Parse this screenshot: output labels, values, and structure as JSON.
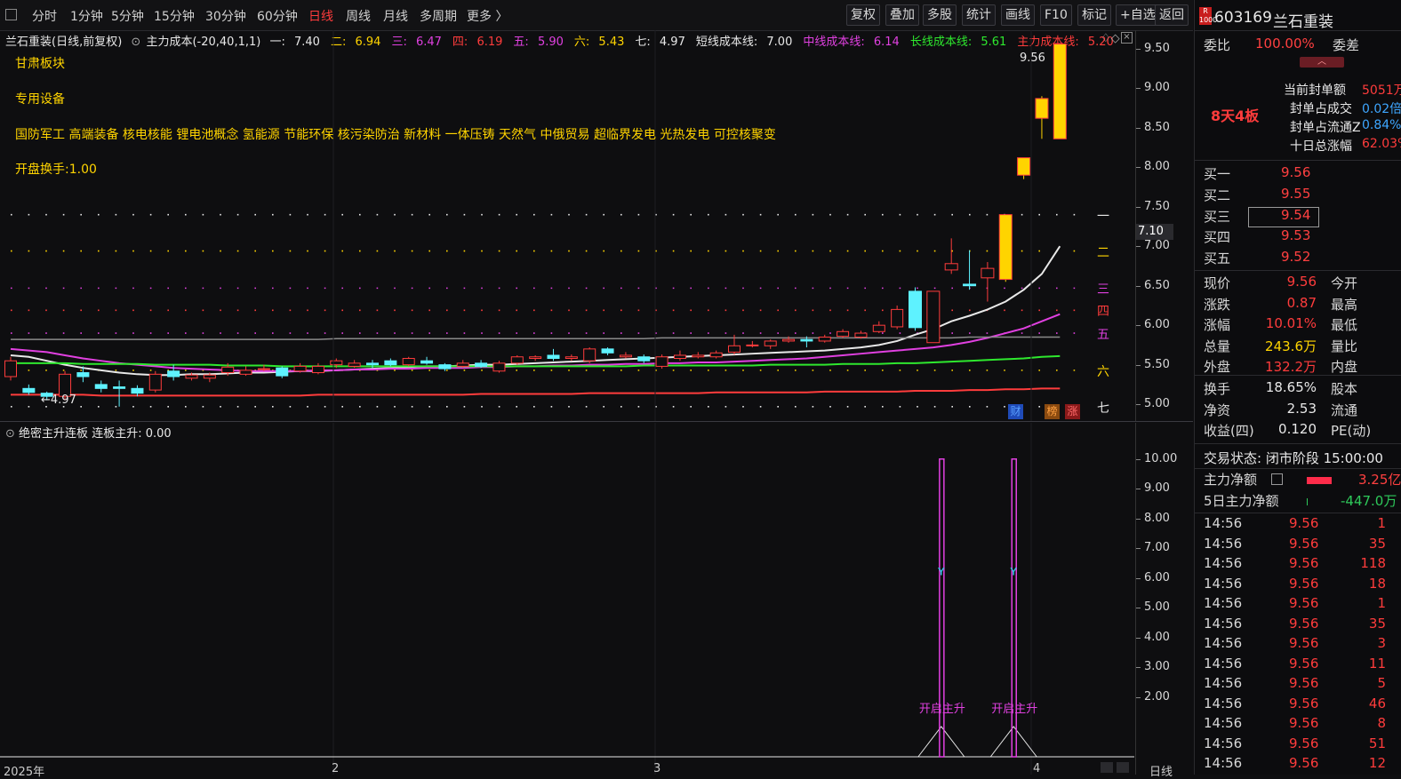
{
  "toolbar": {
    "checkbox_icon": "square-icon",
    "periods": [
      "分时",
      "1分钟",
      "5分钟",
      "15分钟",
      "30分钟",
      "60分钟",
      "日线",
      "周线",
      "月线",
      "多周期",
      "更多 〉"
    ],
    "active_period_index": 6,
    "buttons": [
      "复权",
      "叠加",
      "多股",
      "统计",
      "画线",
      "F10",
      "标记",
      "+自选",
      "返回"
    ]
  },
  "main_chart": {
    "title": "兰石重装(日线,前复权)",
    "indicator_name": "主力成本(-20,40,1,1)",
    "levels": [
      {
        "label": "一:",
        "value": "7.40",
        "color": "#e8e8e8"
      },
      {
        "label": "二:",
        "value": "6.94",
        "color": "#ffd400"
      },
      {
        "label": "三:",
        "value": "6.47",
        "color": "#e040e0"
      },
      {
        "label": "四:",
        "value": "6.19",
        "color": "#ff3c3c"
      },
      {
        "label": "五:",
        "value": "5.90",
        "color": "#e040e0"
      },
      {
        "label": "六:",
        "value": "5.43",
        "color": "#ffd400"
      },
      {
        "label": "七:",
        "value": "4.97",
        "color": "#e8e8e8"
      }
    ],
    "cost_lines": [
      {
        "label": "短线成本线:",
        "value": "7.00",
        "color": "#e8e8e8"
      },
      {
        "label": "中线成本线:",
        "value": "6.14",
        "color": "#e040e0"
      },
      {
        "label": "长线成本线:",
        "value": "5.61",
        "color": "#2ee82e"
      },
      {
        "label": "主力成本线:",
        "value": "5.20",
        "color": "#ff3c3c"
      }
    ],
    "sector": "甘肃板块",
    "industry": "专用设备",
    "concepts": "国防军工 高端装备 核电核能 锂电池概念 氢能源 节能环保 核污染防治 新材料 一体压铸 天然气 中俄贸易 超临界发电 光热发电 可控核聚变",
    "open_turnover": "开盘换手:1.00",
    "high_label": "9.56",
    "low_label": "4.97",
    "price_tag": "7.10",
    "level_marks": [
      "一",
      "二",
      "三",
      "四",
      "五",
      "六",
      "七"
    ],
    "badges": [
      "财",
      "榜",
      "涨"
    ],
    "y_ticks": [
      "9.50",
      "9.00",
      "8.50",
      "8.00",
      "7.50",
      "7.00",
      "6.50",
      "6.00",
      "5.50",
      "5.00"
    ]
  },
  "chart_data": {
    "type": "candlestick",
    "ylim": [
      4.9,
      9.6
    ],
    "y_ticks": [
      5.0,
      5.5,
      6.0,
      6.5,
      7.0,
      7.5,
      8.0,
      8.5,
      9.0,
      9.5
    ],
    "candles": [
      [
        5.35,
        5.55,
        5.6,
        5.3
      ],
      [
        5.2,
        5.15,
        5.25,
        5.12
      ],
      [
        5.14,
        5.1,
        5.16,
        5.05
      ],
      [
        5.1,
        5.38,
        5.42,
        5.05
      ],
      [
        5.4,
        5.35,
        5.48,
        5.28
      ],
      [
        5.25,
        5.2,
        5.3,
        5.15
      ],
      [
        5.22,
        5.2,
        5.3,
        4.97
      ],
      [
        5.2,
        5.14,
        5.24,
        5.1
      ],
      [
        5.18,
        5.38,
        5.42,
        5.15
      ],
      [
        5.42,
        5.35,
        5.5,
        5.3
      ],
      [
        5.33,
        5.37,
        5.4,
        5.3
      ],
      [
        5.33,
        5.37,
        5.4,
        5.28
      ],
      [
        5.4,
        5.47,
        5.52,
        5.36
      ],
      [
        5.38,
        5.43,
        5.48,
        5.36
      ],
      [
        5.45,
        5.45,
        5.5,
        5.42
      ],
      [
        5.46,
        5.36,
        5.48,
        5.33
      ],
      [
        5.42,
        5.48,
        5.52,
        5.4
      ],
      [
        5.4,
        5.48,
        5.52,
        5.38
      ],
      [
        5.5,
        5.55,
        5.58,
        5.46
      ],
      [
        5.48,
        5.52,
        5.56,
        5.46
      ],
      [
        5.52,
        5.5,
        5.56,
        5.46
      ],
      [
        5.55,
        5.5,
        5.58,
        5.48
      ],
      [
        5.5,
        5.58,
        5.6,
        5.48
      ],
      [
        5.55,
        5.52,
        5.6,
        5.5
      ],
      [
        5.5,
        5.45,
        5.52,
        5.42
      ],
      [
        5.48,
        5.52,
        5.56,
        5.46
      ],
      [
        5.52,
        5.48,
        5.56,
        5.46
      ],
      [
        5.42,
        5.52,
        5.55,
        5.4
      ],
      [
        5.52,
        5.6,
        5.62,
        5.5
      ],
      [
        5.58,
        5.6,
        5.62,
        5.55
      ],
      [
        5.62,
        5.58,
        5.7,
        5.55
      ],
      [
        5.58,
        5.6,
        5.63,
        5.55
      ],
      [
        5.55,
        5.7,
        5.72,
        5.52
      ],
      [
        5.7,
        5.65,
        5.72,
        5.62
      ],
      [
        5.6,
        5.62,
        5.66,
        5.58
      ],
      [
        5.6,
        5.55,
        5.63,
        5.52
      ],
      [
        5.48,
        5.6,
        5.63,
        5.45
      ],
      [
        5.58,
        5.62,
        5.68,
        5.55
      ],
      [
        5.6,
        5.62,
        5.66,
        5.58
      ],
      [
        5.6,
        5.65,
        5.68,
        5.58
      ],
      [
        5.66,
        5.74,
        5.88,
        5.63
      ],
      [
        5.74,
        5.75,
        5.8,
        5.72
      ],
      [
        5.74,
        5.8,
        5.82,
        5.7
      ],
      [
        5.8,
        5.82,
        5.86,
        5.78
      ],
      [
        5.82,
        5.8,
        5.86,
        5.72
      ],
      [
        5.8,
        5.85,
        5.88,
        5.78
      ],
      [
        5.86,
        5.92,
        5.95,
        5.84
      ],
      [
        5.85,
        5.9,
        5.93,
        5.83
      ],
      [
        5.92,
        6.0,
        6.05,
        5.9
      ],
      [
        5.98,
        6.2,
        6.25,
        5.95
      ],
      [
        6.43,
        5.97,
        6.48,
        5.93
      ],
      [
        5.78,
        6.43,
        6.43,
        5.78
      ],
      [
        6.7,
        6.78,
        7.1,
        6.65
      ],
      [
        6.52,
        6.5,
        6.95,
        6.45
      ],
      [
        6.6,
        6.72,
        6.8,
        6.3
      ],
      [
        6.58,
        7.4,
        7.4,
        6.55
      ],
      [
        7.9,
        8.12,
        8.12,
        7.85
      ],
      [
        8.62,
        8.87,
        8.9,
        8.36
      ],
      [
        8.36,
        9.56,
        9.56,
        8.36
      ]
    ],
    "series": [
      {
        "name": "短线成本线",
        "color": "#e8e8e8",
        "values": [
          5.62,
          5.6,
          5.55,
          5.5,
          5.46,
          5.43,
          5.4,
          5.38,
          5.37,
          5.37,
          5.38,
          5.38,
          5.39,
          5.4,
          5.4,
          5.41,
          5.42,
          5.42,
          5.43,
          5.44,
          5.45,
          5.46,
          5.47,
          5.48,
          5.48,
          5.49,
          5.5,
          5.5,
          5.51,
          5.52,
          5.53,
          5.54,
          5.55,
          5.56,
          5.57,
          5.58,
          5.59,
          5.6,
          5.61,
          5.62,
          5.63,
          5.64,
          5.65,
          5.66,
          5.67,
          5.68,
          5.7,
          5.72,
          5.75,
          5.8,
          5.88,
          5.95,
          6.05,
          6.12,
          6.2,
          6.3,
          6.45,
          6.65,
          7.0
        ]
      },
      {
        "name": "中线成本线",
        "color": "#e040e0",
        "values": [
          5.7,
          5.68,
          5.66,
          5.62,
          5.58,
          5.55,
          5.52,
          5.5,
          5.48,
          5.46,
          5.45,
          5.44,
          5.43,
          5.42,
          5.42,
          5.42,
          5.42,
          5.43,
          5.43,
          5.44,
          5.44,
          5.45,
          5.45,
          5.46,
          5.46,
          5.46,
          5.47,
          5.47,
          5.48,
          5.48,
          5.49,
          5.49,
          5.5,
          5.5,
          5.51,
          5.51,
          5.52,
          5.52,
          5.53,
          5.53,
          5.54,
          5.55,
          5.56,
          5.57,
          5.58,
          5.6,
          5.62,
          5.64,
          5.66,
          5.68,
          5.7,
          5.72,
          5.75,
          5.79,
          5.84,
          5.9,
          5.96,
          6.05,
          6.14
        ]
      },
      {
        "name": "长线成本线",
        "color": "#2ee82e",
        "values": [
          5.52,
          5.52,
          5.52,
          5.52,
          5.51,
          5.51,
          5.51,
          5.51,
          5.5,
          5.5,
          5.5,
          5.5,
          5.49,
          5.49,
          5.49,
          5.48,
          5.48,
          5.48,
          5.48,
          5.48,
          5.48,
          5.48,
          5.48,
          5.48,
          5.48,
          5.48,
          5.48,
          5.48,
          5.48,
          5.48,
          5.48,
          5.48,
          5.48,
          5.48,
          5.48,
          5.49,
          5.49,
          5.49,
          5.49,
          5.49,
          5.49,
          5.49,
          5.5,
          5.5,
          5.5,
          5.5,
          5.51,
          5.51,
          5.51,
          5.52,
          5.52,
          5.53,
          5.54,
          5.55,
          5.56,
          5.57,
          5.58,
          5.6,
          5.61
        ]
      },
      {
        "name": "主力成本线",
        "color": "#ff3c3c",
        "values": [
          5.12,
          5.12,
          5.12,
          5.12,
          5.12,
          5.11,
          5.11,
          5.11,
          5.11,
          5.11,
          5.11,
          5.11,
          5.11,
          5.11,
          5.11,
          5.11,
          5.11,
          5.12,
          5.12,
          5.12,
          5.12,
          5.12,
          5.12,
          5.12,
          5.12,
          5.12,
          5.13,
          5.13,
          5.13,
          5.13,
          5.13,
          5.13,
          5.14,
          5.14,
          5.14,
          5.14,
          5.14,
          5.14,
          5.14,
          5.15,
          5.15,
          5.15,
          5.15,
          5.15,
          5.15,
          5.16,
          5.16,
          5.16,
          5.16,
          5.16,
          5.17,
          5.17,
          5.17,
          5.18,
          5.18,
          5.19,
          5.19,
          5.2,
          5.2
        ]
      },
      {
        "name": "gray",
        "color": "#8a8a8a",
        "values": [
          5.82,
          5.82,
          5.82,
          5.82,
          5.82,
          5.82,
          5.82,
          5.82,
          5.82,
          5.82,
          5.82,
          5.82,
          5.82,
          5.82,
          5.82,
          5.82,
          5.82,
          5.82,
          5.83,
          5.83,
          5.83,
          5.83,
          5.83,
          5.83,
          5.83,
          5.83,
          5.83,
          5.83,
          5.83,
          5.83,
          5.83,
          5.83,
          5.83,
          5.83,
          5.83,
          5.83,
          5.84,
          5.84,
          5.84,
          5.84,
          5.84,
          5.84,
          5.84,
          5.84,
          5.84,
          5.84,
          5.84,
          5.84,
          5.84,
          5.84,
          5.84,
          5.84,
          5.84,
          5.85,
          5.85,
          5.85,
          5.85,
          5.85,
          5.85
        ]
      }
    ],
    "dotted_levels": [
      7.4,
      6.94,
      6.47,
      6.19,
      5.9,
      5.43,
      4.97
    ],
    "indicator": {
      "title": "绝密主升连板",
      "name": "连板主升:",
      "value": "0.00",
      "ylim": [
        0,
        10.5
      ],
      "y_ticks": [
        "10.00",
        "9.00",
        "8.00",
        "7.00",
        "6.00",
        "5.00",
        "4.00",
        "3.00",
        "2.00"
      ],
      "signals": [
        {
          "index": 51,
          "value": 10,
          "label": "开启主升"
        },
        {
          "index": 55,
          "value": 10,
          "label": "开启主升"
        }
      ]
    },
    "x_labels": [
      "2025年",
      "2",
      "3",
      "4"
    ],
    "x_label_end": "日线"
  },
  "right_panel": {
    "code": "603169",
    "name": "兰石重装",
    "webi_label": "委比",
    "webi_value": "100.00%",
    "weicha_label": "委差",
    "board": "8天4板",
    "seal_items": [
      {
        "label": "当前封单额",
        "value": "5051万",
        "color": "#ff3c3c"
      },
      {
        "label": "封单占成交",
        "value": "0.02倍",
        "color": "#3ea6ff"
      },
      {
        "label": "封单占流通Z",
        "value": "0.84%",
        "color": "#3ea6ff"
      },
      {
        "label": "十日总涨幅",
        "value": "62.03%",
        "color": "#ff3c3c"
      }
    ],
    "bids": [
      {
        "label": "买一",
        "price": "9.56"
      },
      {
        "label": "买二",
        "price": "9.55"
      },
      {
        "label": "买三",
        "price": "9.54"
      },
      {
        "label": "买四",
        "price": "9.53"
      },
      {
        "label": "买五",
        "price": "9.52"
      }
    ],
    "quote_left": [
      {
        "label": "现价",
        "value": "9.56",
        "color": "#ff3c3c"
      },
      {
        "label": "涨跌",
        "value": "0.87",
        "color": "#ff3c3c"
      },
      {
        "label": "涨幅",
        "value": "10.01%",
        "color": "#ff3c3c"
      },
      {
        "label": "总量",
        "value": "243.6万",
        "color": "#ffd400"
      },
      {
        "label": "外盘",
        "value": "132.2万",
        "color": "#ff3c3c"
      }
    ],
    "quote_right": [
      "今开",
      "最高",
      "最低",
      "量比",
      "内盘"
    ],
    "stats_left": [
      {
        "label": "换手",
        "value": "18.65%"
      },
      {
        "label": "净资",
        "value": "2.53"
      },
      {
        "label": "收益(四)",
        "value": "0.120"
      }
    ],
    "stats_right": [
      "股本",
      "流通",
      "PE(动)"
    ],
    "trade_status": "交易状态: 闭市阶段 15:00:00",
    "main_net": {
      "label": "主力净额",
      "value": "3.25亿"
    },
    "main_net5": {
      "label": "5日主力净额",
      "value": "-447.0万"
    },
    "ticks": [
      {
        "time": "14:56",
        "price": "9.56",
        "vol": "1"
      },
      {
        "time": "14:56",
        "price": "9.56",
        "vol": "35"
      },
      {
        "time": "14:56",
        "price": "9.56",
        "vol": "118"
      },
      {
        "time": "14:56",
        "price": "9.56",
        "vol": "18"
      },
      {
        "time": "14:56",
        "price": "9.56",
        "vol": "1"
      },
      {
        "time": "14:56",
        "price": "9.56",
        "vol": "35"
      },
      {
        "time": "14:56",
        "price": "9.56",
        "vol": "3"
      },
      {
        "time": "14:56",
        "price": "9.56",
        "vol": "11"
      },
      {
        "time": "14:56",
        "price": "9.56",
        "vol": "5"
      },
      {
        "time": "14:56",
        "price": "9.56",
        "vol": "46"
      },
      {
        "time": "14:56",
        "price": "9.56",
        "vol": "8"
      },
      {
        "time": "14:56",
        "price": "9.56",
        "vol": "51"
      },
      {
        "time": "14:56",
        "price": "9.56",
        "vol": "12"
      }
    ]
  }
}
